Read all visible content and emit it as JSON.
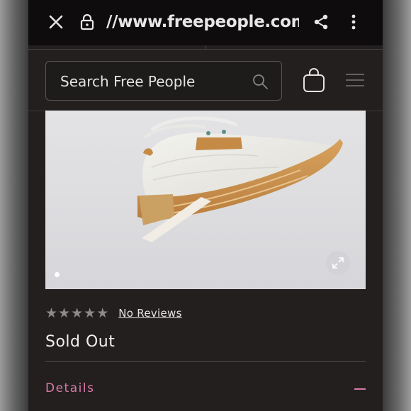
{
  "browser": {
    "url": "//www.freepeople.com/s",
    "close_icon": "close-icon",
    "lock_icon": "lock-icon",
    "share_icon": "share-icon",
    "more_icon": "more-vertical-icon"
  },
  "header": {
    "search_placeholder": "Search Free People",
    "search_icon": "search-icon",
    "bag_icon": "shopping-bag-icon",
    "menu_icon": "hamburger-menu-icon"
  },
  "product": {
    "image_alt_icon": "expand-icon",
    "carousel_count": 1,
    "carousel_active": 1,
    "rating_value": 0,
    "rating_max": 5,
    "reviews_label": "No Reviews",
    "status": "Sold Out",
    "details_label": "Details",
    "details_icon": "minus-icon"
  },
  "colors": {
    "accent": "#d77aa8",
    "background": "#231f1f"
  }
}
